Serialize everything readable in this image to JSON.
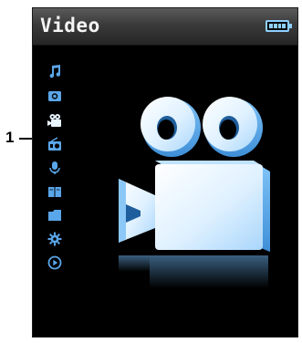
{
  "header": {
    "title": "Video",
    "battery_icon": "battery-full-icon"
  },
  "menu": {
    "items": [
      {
        "icon": "music-note-icon"
      },
      {
        "icon": "photo-icon"
      },
      {
        "icon": "video-camera-icon",
        "selected": true
      },
      {
        "icon": "radio-icon"
      },
      {
        "icon": "microphone-record-icon"
      },
      {
        "icon": "book-icon"
      },
      {
        "icon": "folder-icon"
      },
      {
        "icon": "settings-gear-icon"
      },
      {
        "icon": "play-circle-icon"
      }
    ]
  },
  "callout": {
    "number": "1"
  },
  "hero": {
    "icon": "video-camera-icon"
  },
  "colors": {
    "screen_bg": "#000000",
    "accent": "#6fb8f4",
    "selected_icon": "#e8f4ff",
    "header_text": "#f4f4f4"
  }
}
